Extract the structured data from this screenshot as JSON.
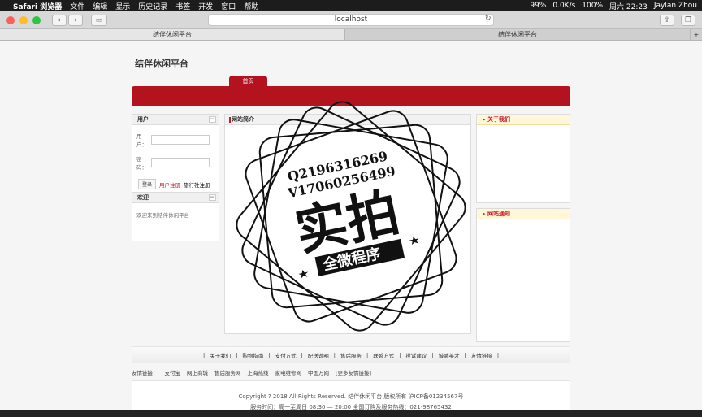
{
  "menubar": {
    "apple_icon": "apple-icon",
    "items": [
      "Safari 浏览器",
      "文件",
      "编辑",
      "显示",
      "历史记录",
      "书签",
      "开发",
      "窗口",
      "帮助"
    ],
    "status": {
      "battery": "99%",
      "network": "0.0K/s",
      "wifi": "100%",
      "time": "周六 22:23",
      "user": "Jaylan Zhou"
    }
  },
  "browser": {
    "url": "localhost",
    "tabs": [
      "结伴休闲平台",
      "结伴休闲平台"
    ]
  },
  "site": {
    "title": "结伴休闲平台",
    "nav_tab": "首页",
    "user_box": {
      "title": "用户",
      "user_label": "用户：",
      "pass_label": "密码：",
      "login_btn": "登录",
      "register_link": "用户注册",
      "agency_link": "旅行社注册"
    },
    "welcome_box": {
      "title": "欢迎",
      "text": "欢迎来到结伴休闲平台"
    },
    "intro_box": {
      "title": "网站简介"
    },
    "about_box": {
      "title": "关于我们"
    },
    "notice_box": {
      "title": "网站通知"
    },
    "footer_nav": [
      "关于我们",
      "购物指南",
      "支付方式",
      "配送说明",
      "售后服务",
      "联系方式",
      "投诉建议",
      "诚聘英才",
      "友情链接"
    ],
    "friend_links": {
      "label": "友情链接：",
      "items": [
        "支付宝",
        "网上商城",
        "售后服务网",
        "上海热线",
        "家电维修网",
        "中国万网",
        "[更多友情链接]"
      ]
    },
    "copyright": "Copyright ? 2018 All Rights Reserved. 结伴休闲平台 版权所有  沪ICP备01234567号",
    "service": "服务时间：周一至周日 08:30 — 20:00  全国订购及服务热线：021-98765432"
  },
  "watermark": {
    "line1": "Q2196316269",
    "line2": "V17060256499",
    "main": "实拍",
    "sub": "全微程序"
  }
}
